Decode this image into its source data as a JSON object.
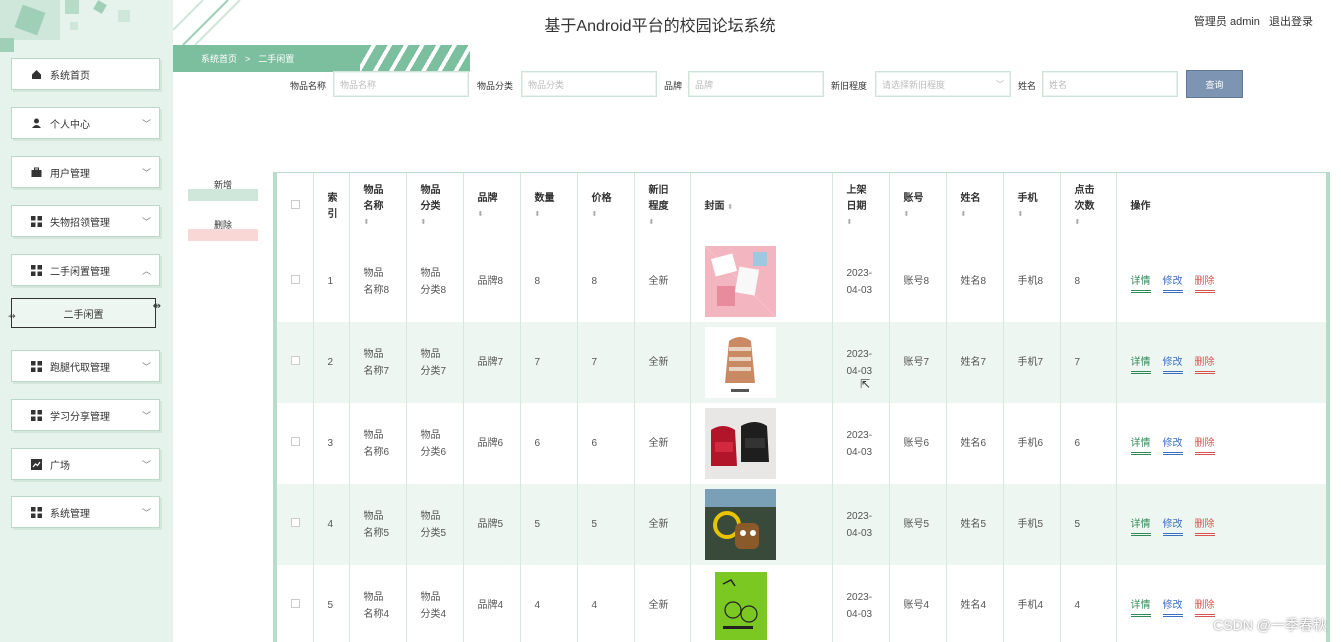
{
  "header": {
    "title": "基于Android平台的校园论坛系统",
    "user_label": "管理员 admin",
    "logout_label": "退出登录"
  },
  "sidebar": {
    "items": [
      {
        "label": "系统首页",
        "icon": "home-icon",
        "expanded": false,
        "has_chevron": false
      },
      {
        "label": "个人中心",
        "icon": "user-icon",
        "expanded": false,
        "has_chevron": true
      },
      {
        "label": "用户管理",
        "icon": "briefcase-icon",
        "expanded": false,
        "has_chevron": true
      },
      {
        "label": "失物招领管理",
        "icon": "grid-icon",
        "expanded": false,
        "has_chevron": true
      },
      {
        "label": "二手闲置管理",
        "icon": "grid-icon",
        "expanded": true,
        "has_chevron": true
      },
      {
        "label": "跑腿代取管理",
        "icon": "grid-icon",
        "expanded": false,
        "has_chevron": true
      },
      {
        "label": "学习分享管理",
        "icon": "grid-icon",
        "expanded": false,
        "has_chevron": true
      },
      {
        "label": "广场",
        "icon": "chart-icon",
        "expanded": false,
        "has_chevron": true
      },
      {
        "label": "系统管理",
        "icon": "grid-icon",
        "expanded": false,
        "has_chevron": true
      }
    ],
    "sub_item": "二手闲置"
  },
  "breadcrumb": {
    "home": "系统首页",
    "sep": ">",
    "current": "二手闲置"
  },
  "search": {
    "name_label": "物品名称",
    "name_placeholder": "物品名称",
    "category_label": "物品分类",
    "category_placeholder": "物品分类",
    "brand_label": "品牌",
    "brand_placeholder": "品牌",
    "condition_label": "新旧程度",
    "condition_placeholder": "请选择新旧程度",
    "owner_label": "姓名",
    "owner_placeholder": "姓名",
    "button": "查询"
  },
  "actions": {
    "add": "新增",
    "delete": "删除"
  },
  "table": {
    "headers": {
      "index": "索引",
      "name": "物品名称",
      "category": "物品分类",
      "brand": "品牌",
      "quantity": "数量",
      "price": "价格",
      "condition": "新旧程度",
      "cover": "封面",
      "date": "上架日期",
      "account": "账号",
      "owner": "姓名",
      "phone": "手机",
      "clicks": "点击次数",
      "ops": "操作"
    },
    "header_display": {
      "index": [
        "索",
        "引"
      ],
      "name": [
        "物品",
        "名称"
      ],
      "category": [
        "物品",
        "分类"
      ],
      "condition": [
        "新旧",
        "程度"
      ],
      "date": [
        "上架",
        "日期"
      ],
      "clicks": [
        "点击",
        "次数"
      ]
    },
    "rows": [
      {
        "index": "1",
        "name": [
          "物品",
          "名称8"
        ],
        "category": [
          "物品",
          "分类8"
        ],
        "brand": "品牌8",
        "quantity": "8",
        "price": "8",
        "condition": "全新",
        "cover": "cover-pink-items",
        "date": [
          "2023-",
          "04-03"
        ],
        "account": "账号8",
        "owner": "姓名8",
        "phone": "手机8",
        "clicks": "8"
      },
      {
        "index": "2",
        "name": [
          "物品",
          "名称7"
        ],
        "category": [
          "物品",
          "分类7"
        ],
        "brand": "品牌7",
        "quantity": "7",
        "price": "7",
        "condition": "全新",
        "cover": "cover-backpack",
        "date": [
          "2023-",
          "04-03"
        ],
        "account": "账号7",
        "owner": "姓名7",
        "phone": "手机7",
        "clicks": "7"
      },
      {
        "index": "3",
        "name": [
          "物品",
          "名称6"
        ],
        "category": [
          "物品",
          "分类6"
        ],
        "brand": "品牌6",
        "quantity": "6",
        "price": "6",
        "condition": "全新",
        "cover": "cover-bags",
        "date": [
          "2023-",
          "04-03"
        ],
        "account": "账号6",
        "owner": "姓名6",
        "phone": "手机6",
        "clicks": "6"
      },
      {
        "index": "4",
        "name": [
          "物品",
          "名称5"
        ],
        "category": [
          "物品",
          "分类5"
        ],
        "brand": "品牌5",
        "quantity": "5",
        "price": "5",
        "condition": "全新",
        "cover": "cover-keychain",
        "date": [
          "2023-",
          "04-03"
        ],
        "account": "账号5",
        "owner": "姓名5",
        "phone": "手机5",
        "clicks": "5"
      },
      {
        "index": "5",
        "name": [
          "物品",
          "名称4"
        ],
        "category": [
          "物品",
          "分类4"
        ],
        "brand": "品牌4",
        "quantity": "4",
        "price": "4",
        "condition": "全新",
        "cover": "cover-book",
        "date": [
          "2023-",
          "04-03"
        ],
        "account": "账号4",
        "owner": "姓名4",
        "phone": "手机4",
        "clicks": "4"
      }
    ],
    "ops": {
      "detail": "详情",
      "edit": "修改",
      "delete": "删除"
    }
  },
  "watermark": "CSDN @一季春秋",
  "colors": {
    "sidebar_bg": "#e6f3ec",
    "accent": "#7cbf9f",
    "row_alt": "#edf6f1",
    "search_btn": "#7d95b3",
    "op_detail": "#2e8b57",
    "op_edit": "#3b6fc2",
    "op_delete": "#d9534f"
  }
}
